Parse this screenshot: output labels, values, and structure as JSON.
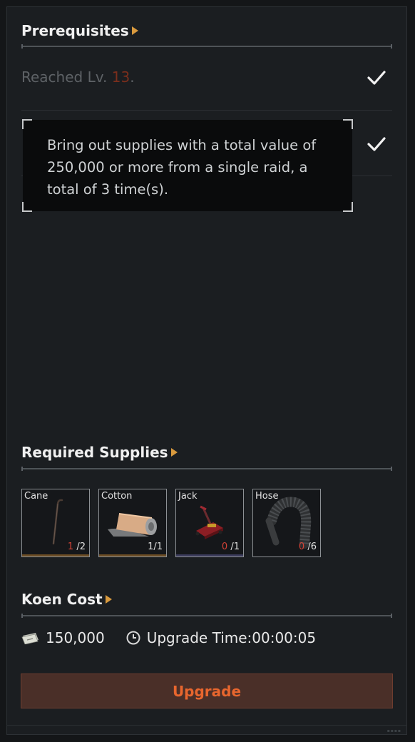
{
  "prerequisites": {
    "title": "Prerequisites",
    "level_text_prefix": "Reached Lv. ",
    "level_value": "13",
    "level_text_suffix": ".",
    "tooltip_text": "Bring out supplies with a total value of 250,000 or more from a single raid, a total of 3 time(s)."
  },
  "supplies": {
    "title": "Required Supplies",
    "items": [
      {
        "name": "Cane",
        "have": "1",
        "need": "/2",
        "icon": "cane-icon"
      },
      {
        "name": "Cotton",
        "have": "1",
        "need": "/1",
        "icon": "cotton-roll-icon"
      },
      {
        "name": "Jack",
        "have": "0",
        "need": "/1",
        "icon": "car-jack-icon"
      },
      {
        "name": "Hose",
        "have": "0",
        "need": "/6",
        "icon": "hose-icon"
      }
    ]
  },
  "cost": {
    "title": "Koen Cost",
    "amount": "150,000",
    "upgrade_time": "Upgrade Time:00:00:05"
  },
  "actions": {
    "upgrade_label": "Upgrade"
  },
  "colors": {
    "accent_orange": "#e8662e",
    "arrow_gold": "#d99a3e",
    "missing_red": "#d44236",
    "level_red": "#7a2e1c"
  }
}
